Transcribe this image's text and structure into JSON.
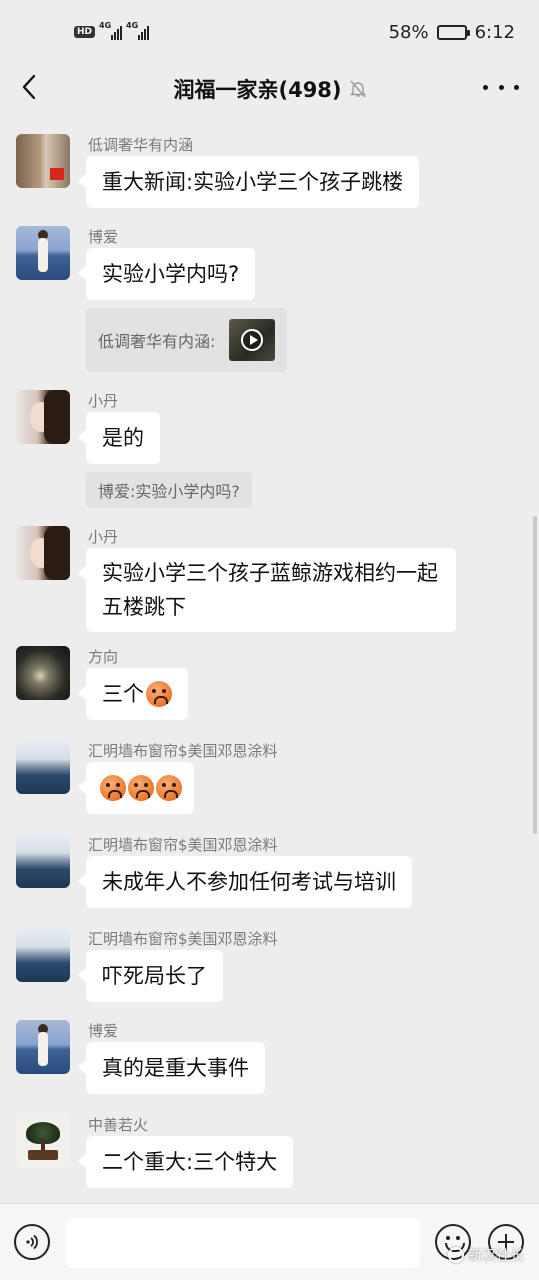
{
  "status_bar": {
    "hd_label": "HD",
    "network_1": "4G",
    "network_2": "4G",
    "battery_percent": "58%",
    "battery_level": 0.58,
    "time": "6:12"
  },
  "nav": {
    "back_icon": "chevron-left-icon",
    "title": "润福一家亲(498)",
    "mute_icon": "bell-off-icon",
    "more_icon": "more-dots-icon"
  },
  "messages": [
    {
      "sender": "低调奢华有内涵",
      "text": "重大新闻:实验小学三个孩子跳楼"
    },
    {
      "sender": "博爱",
      "text": "实验小学内吗?",
      "quote": "低调奢华有内涵:"
    },
    {
      "sender": "小丹",
      "text": "是的",
      "quote": "博爱:实验小学内吗?"
    },
    {
      "sender": "小丹",
      "text": "实验小学三个孩子蓝鲸游戏相约一起五楼跳下"
    },
    {
      "sender": "方向",
      "text": "三个",
      "emoji": "sad-face-emoji"
    },
    {
      "sender": "汇明墙布窗帘$美国邓恩涂料",
      "emoji": "sad-face-emoji",
      "emoji_count": 3
    },
    {
      "sender": "汇明墙布窗帘$美国邓恩涂料",
      "text": "未成年人不参加任何考试与培训"
    },
    {
      "sender": "汇明墙布窗帘$美国邓恩涂料",
      "text": "吓死局长了"
    },
    {
      "sender": "博爱",
      "text": "真的是重大事件"
    },
    {
      "sender": "中善若火",
      "text": "二个重大:三个特大"
    }
  ],
  "input_bar": {
    "voice_icon": "voice-icon",
    "message_value": "",
    "emoji_icon": "emoji-icon",
    "plus_icon": "plus-icon"
  },
  "watermark": {
    "text": "新汉社长"
  },
  "colors": {
    "chat_background": "#ededed",
    "bubble": "#ffffff",
    "quote_background": "#e2e2e2",
    "sender_name": "#7a7a7a"
  }
}
